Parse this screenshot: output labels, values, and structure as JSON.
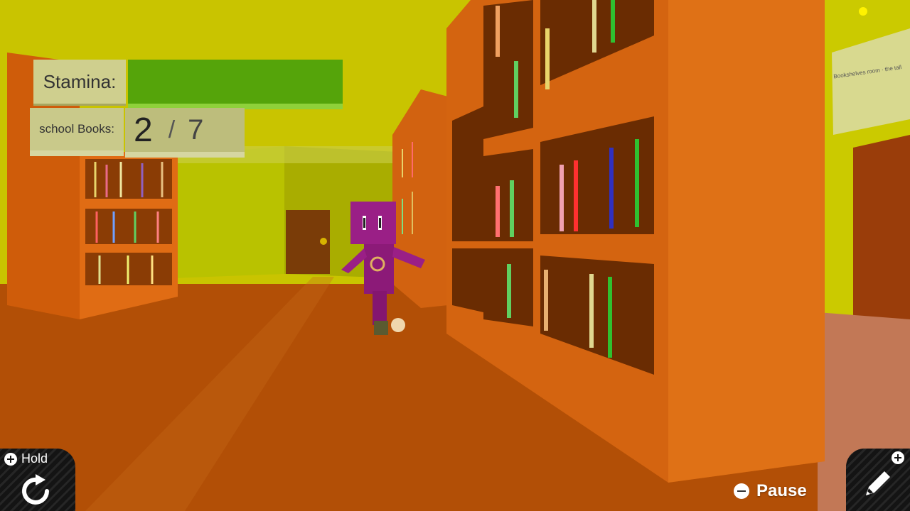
{
  "hud": {
    "stamina_label": "Stamina:",
    "stamina_level": 1.0,
    "books_label": "school Books:",
    "books_collected": "2",
    "books_separator": "/",
    "books_total": "7"
  },
  "controls": {
    "hold_label": "Hold",
    "pause_label": "Pause",
    "hold_icon": "rotate-icon",
    "edit_icon": "pencil-icon",
    "plus_icon": "plus-icon",
    "minus_icon": "minus-icon"
  },
  "scene": {
    "sign_text": "Bookshelves room · the tall",
    "colors": {
      "wall": "#c8c400",
      "floor": "#b24f06",
      "shelf": "#d76510",
      "character": "#9a1f86",
      "stamina": "#55a40a"
    }
  }
}
